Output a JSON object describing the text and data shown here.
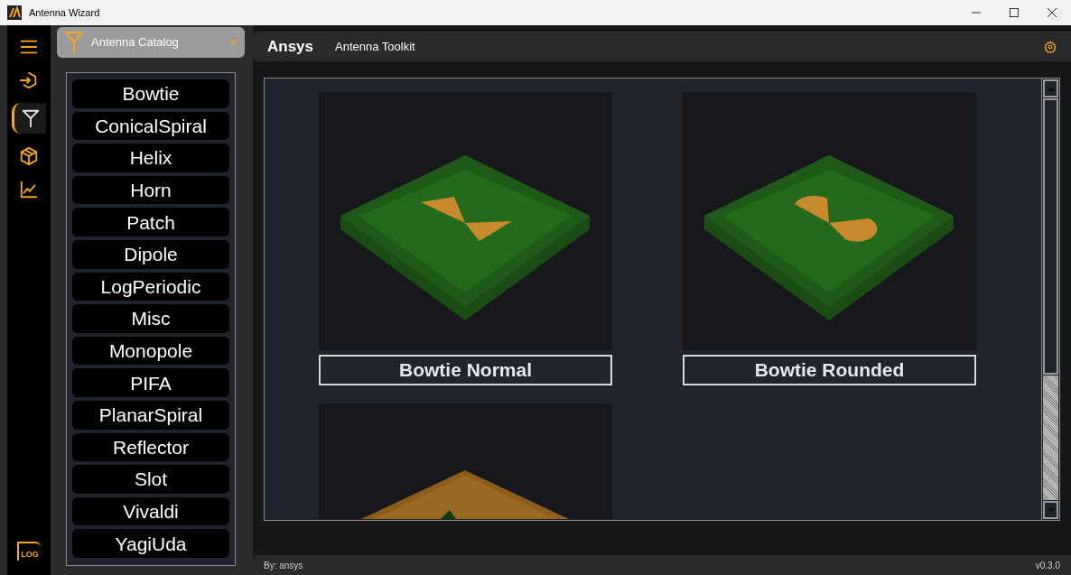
{
  "window": {
    "title": "Antenna Wizard"
  },
  "rail": [
    {
      "kind": "menu",
      "selected": false
    },
    {
      "kind": "login",
      "selected": false
    },
    {
      "kind": "antenna",
      "selected": true
    },
    {
      "kind": "cube",
      "selected": false
    },
    {
      "kind": "chart",
      "selected": false
    }
  ],
  "rail_log": {
    "label": "LOG"
  },
  "catalog_tab": {
    "label": "Antenna Catalog",
    "close": "×"
  },
  "catalog": [
    "Bowtie",
    "ConicalSpiral",
    "Helix",
    "Horn",
    "Patch",
    "Dipole",
    "LogPeriodic",
    "Misc",
    "Monopole",
    "PIFA",
    "PlanarSpiral",
    "Reflector",
    "Slot",
    "Vivaldi",
    "YagiUda"
  ],
  "header": {
    "logo": "Ansys",
    "title": "Antenna Toolkit"
  },
  "cards": [
    {
      "kind": "normal",
      "title": "Bowtie Normal"
    },
    {
      "kind": "rounded",
      "title": "Bowtie Rounded"
    },
    {
      "kind": "pyramid"
    }
  ],
  "status_bar": {
    "author": "By: ansys",
    "version": "v0.3.0"
  }
}
